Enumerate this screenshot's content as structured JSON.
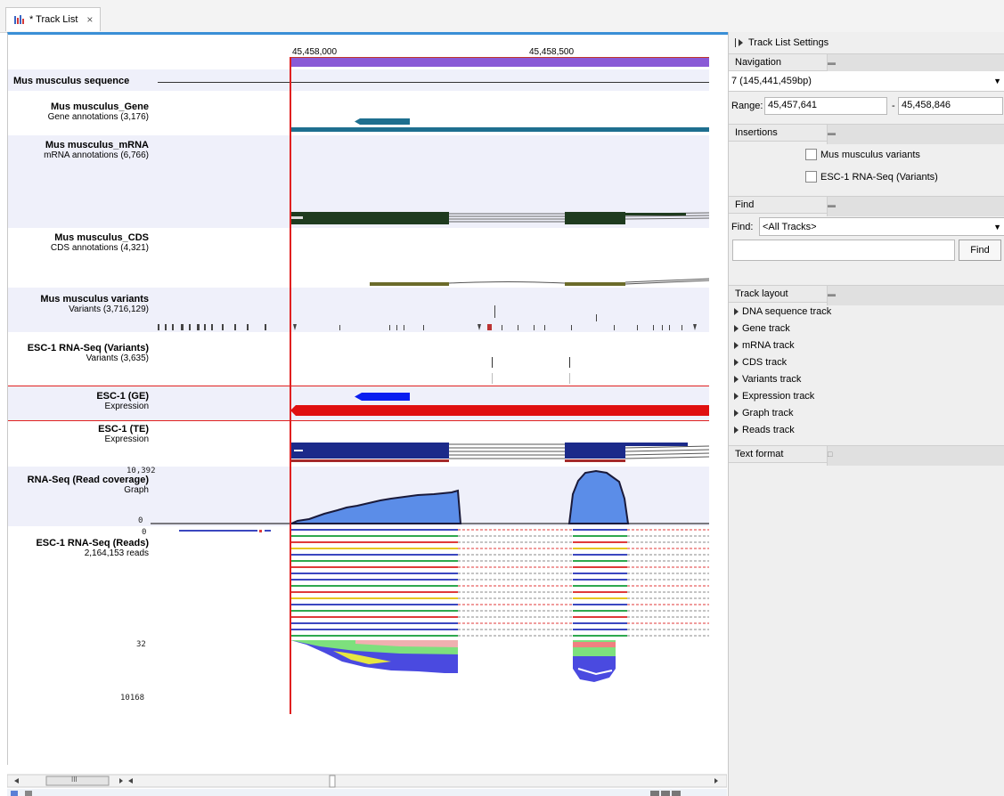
{
  "tab": {
    "title": "* Track List",
    "close": "×"
  },
  "ruler": {
    "pos1": "45,458,000",
    "pos2": "45,458,500"
  },
  "tracks": {
    "sequence": {
      "name": "Mus musculus sequence"
    },
    "gene": {
      "name": "Mus musculus_Gene",
      "sub": "Gene annotations (3,176)"
    },
    "mrna": {
      "name": "Mus musculus_mRNA",
      "sub": "mRNA annotations (6,766)"
    },
    "cds": {
      "name": "Mus musculus_CDS",
      "sub": "CDS annotations (4,321)"
    },
    "variants": {
      "name": "Mus musculus variants",
      "sub": "Variants (3,716,129)"
    },
    "esc_variants": {
      "name": "ESC-1 RNA-Seq (Variants)",
      "sub": "Variants (3,635)"
    },
    "ge": {
      "name": "ESC-1 (GE)",
      "sub": "Expression"
    },
    "te": {
      "name": "ESC-1 (TE)",
      "sub": "Expression"
    },
    "coverage": {
      "name": "RNA-Seq (Read coverage)",
      "sub": "Graph",
      "max": "10,392",
      "min": "0"
    },
    "reads": {
      "name": "ESC-1 RNA-Seq (Reads)",
      "sub": "2,164,153 reads",
      "top": "0",
      "mid": "32",
      "bottom": "10168"
    }
  },
  "panel": {
    "title": "Track List Settings",
    "navigation": {
      "header": "Navigation",
      "chromosome": "7 (145,441,459bp)",
      "range_label": "Range:",
      "range_start": "45,457,641",
      "range_sep": "-",
      "range_end": "45,458,846"
    },
    "insertions": {
      "header": "Insertions",
      "items": [
        "Mus musculus variants",
        "ESC-1 RNA-Seq (Variants)"
      ]
    },
    "find": {
      "header": "Find",
      "label": "Find:",
      "scope": "<All Tracks>",
      "button": "Find"
    },
    "track_layout": {
      "header": "Track layout",
      "items": [
        "DNA sequence track",
        "Gene track",
        "mRNA track",
        "CDS track",
        "Variants track",
        "Expression track",
        "Graph track",
        "Reads track"
      ]
    },
    "text_format": {
      "header": "Text format"
    }
  },
  "scrollbar": {
    "grip": "III"
  },
  "colors": {
    "accent": "#3a8fd6",
    "cursor_line": "#e02020",
    "gene": "#1e6f8f",
    "mrna": "#1f3b1f",
    "coverage": "#5b8de8",
    "ge": "#e01010"
  }
}
